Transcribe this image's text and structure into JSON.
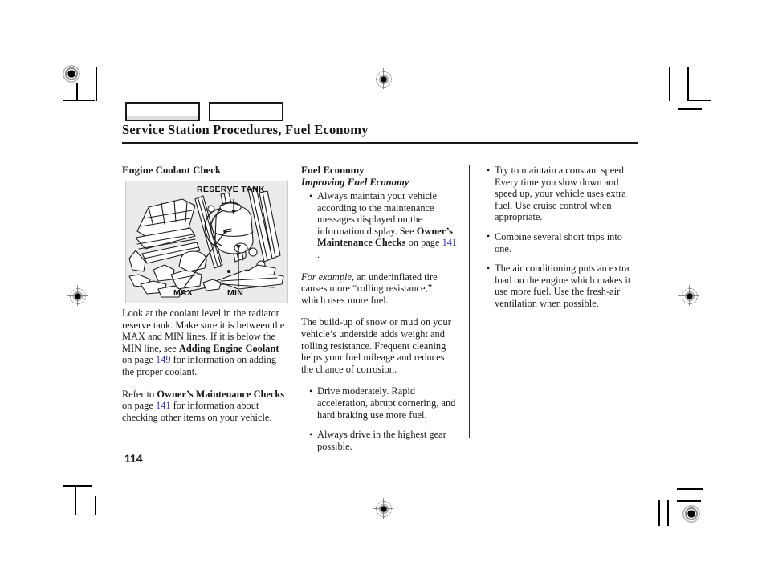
{
  "page": {
    "number": "114",
    "title": "Service Station Procedures, Fuel Economy"
  },
  "tabs": [
    {
      "name": "tab-box-1",
      "label": ""
    },
    {
      "name": "tab-box-2",
      "label": ""
    }
  ],
  "columns": {
    "left": {
      "heading": "Engine Coolant Check",
      "figure": {
        "label_tank": "RESERVE TANK",
        "label_max": "MAX",
        "label_min": "MIN",
        "alt": "engine-bay-coolant-reserve-tank-illustration"
      },
      "paragraph_1": {
        "part_1": "Look at the coolant level in the radiator reserve tank. Make sure it is between the MAX and MIN lines. If it is below the MIN line, see ",
        "bold_1": "Adding Engine Coolant",
        "part_2": " on page ",
        "ref_1": "149",
        "part_3": " for information on adding the proper coolant."
      },
      "paragraph_2": {
        "part_1": "Refer to ",
        "bold_1": "Owner’s Maintenance Checks",
        "part_2": " on page ",
        "ref_1": "141",
        "part_3": " for information about checking other items on your vehicle."
      }
    },
    "middle": {
      "heading": "Fuel Economy",
      "subheading": "Improving Fuel Economy",
      "bullet_1": {
        "part_1": "Always maintain your vehicle according to the maintenance messages displayed on the information display. See ",
        "bold_1": "Owner’s Maintenance Checks",
        "part_2": " on page ",
        "ref_1": "141",
        "part_3": " ."
      },
      "paragraph_1": {
        "italic_1": "For example,",
        "part_1": " an underinflated tire causes more “rolling resistance,” which uses more fuel."
      },
      "paragraph_2": "The build-up of snow or mud on your vehicle’s underside adds weight and rolling resistance. Frequent cleaning helps your fuel mileage and reduces the chance of corrosion.",
      "bullet_2": "Drive moderately. Rapid acceleration, abrupt cornering, and hard braking use more fuel.",
      "bullet_3": "Always drive in the highest gear possible."
    },
    "right": {
      "bullet_1": "Try to maintain a constant speed. Every time you slow down and speed up, your vehicle uses extra fuel. Use cruise control when appropriate.",
      "bullet_2": "Combine several short trips into one.",
      "bullet_3": "The air conditioning puts an extra load on the engine which makes it use more fuel. Use the fresh-air ventilation when possible."
    }
  },
  "colors": {
    "page_reference": "#3333CC",
    "text": "#1A1A1A",
    "figure_background": "#EBEBEB"
  }
}
